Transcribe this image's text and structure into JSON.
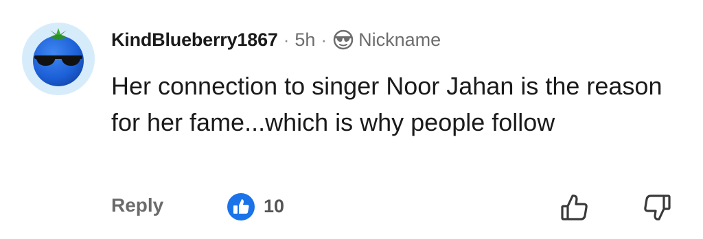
{
  "comment": {
    "username": "KindBlueberry1867",
    "separator": "·",
    "time": "5h",
    "flair_label": "Nickname",
    "text": "Her connection to singer Noor Jahan is the reason for her fame...which is why people follow"
  },
  "actions": {
    "reply_label": "Reply",
    "like_count": "10"
  },
  "icons": {
    "avatar": "blueberry-sunglasses-avatar",
    "flair": "sunglasses-face-icon",
    "like_badge": "blue-thumbs-up-badge",
    "thumb_up": "thumbs-up-outline-icon",
    "thumb_down": "thumbs-down-outline-icon"
  },
  "colors": {
    "accent_blue": "#1a73e8",
    "avatar_bg": "#d7ecfb",
    "text_dark": "#1a1a1a",
    "text_muted": "#6d6d6d"
  }
}
